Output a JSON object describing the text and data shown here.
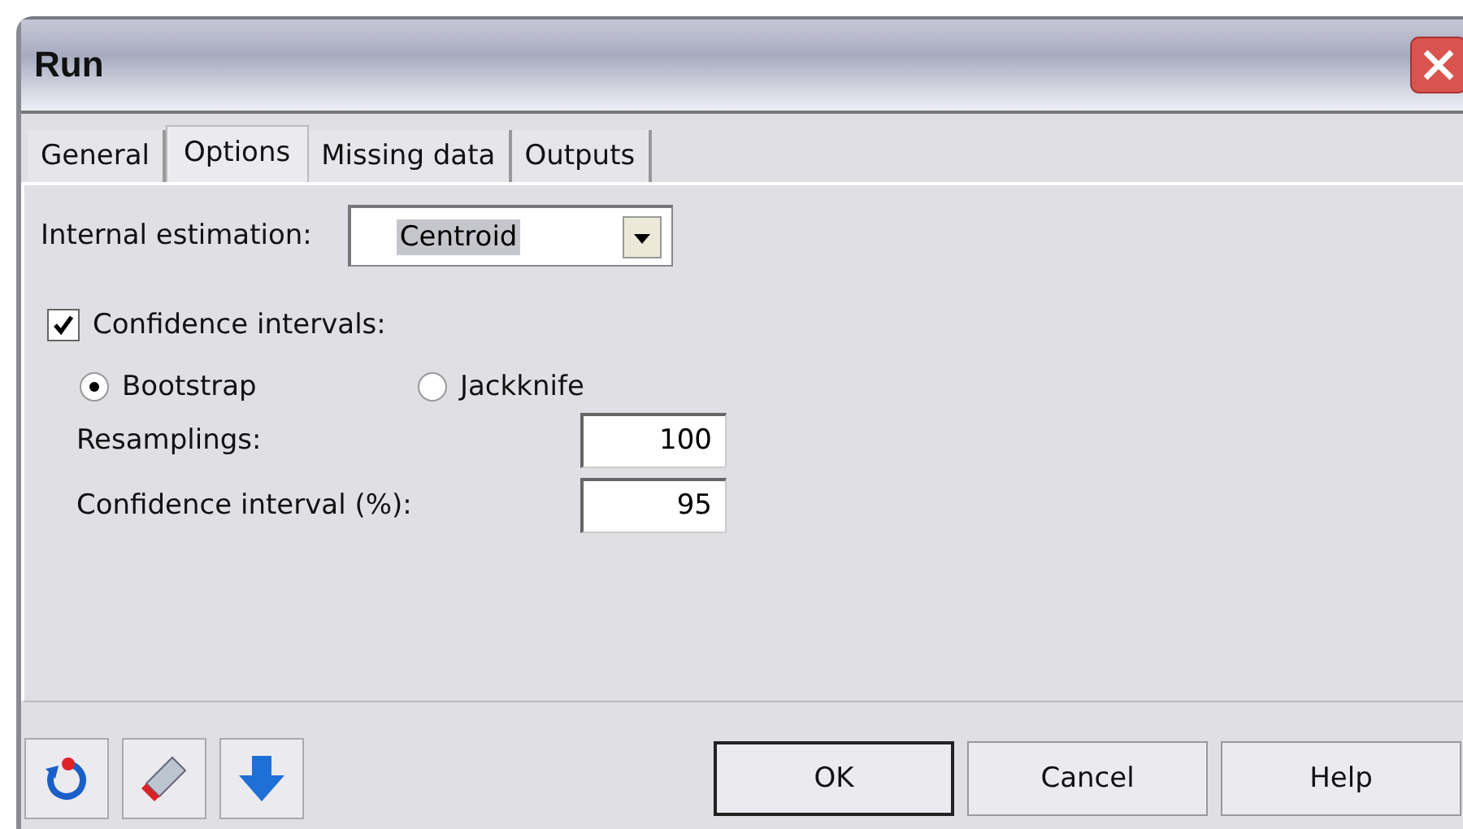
{
  "window": {
    "title": "Run"
  },
  "tabs": [
    {
      "label": "General",
      "selected": false
    },
    {
      "label": "Options",
      "selected": true
    },
    {
      "label": "Missing data",
      "selected": false
    },
    {
      "label": "Outputs",
      "selected": false
    }
  ],
  "internal_estimation": {
    "label": "Internal estimation:",
    "value": "Centroid"
  },
  "confidence_intervals": {
    "label": "Confidence intervals:",
    "checked": true
  },
  "methods": [
    {
      "label": "Bootstrap",
      "selected": true
    },
    {
      "label": "Jackknife",
      "selected": false
    }
  ],
  "fields": [
    {
      "label": "Resamplings:",
      "value": "100"
    },
    {
      "label": "Confidence interval (%):",
      "value": "95"
    }
  ],
  "buttons": [
    {
      "label": "OK",
      "default": true
    },
    {
      "label": "Cancel",
      "default": false
    },
    {
      "label": "Help",
      "default": false
    }
  ]
}
